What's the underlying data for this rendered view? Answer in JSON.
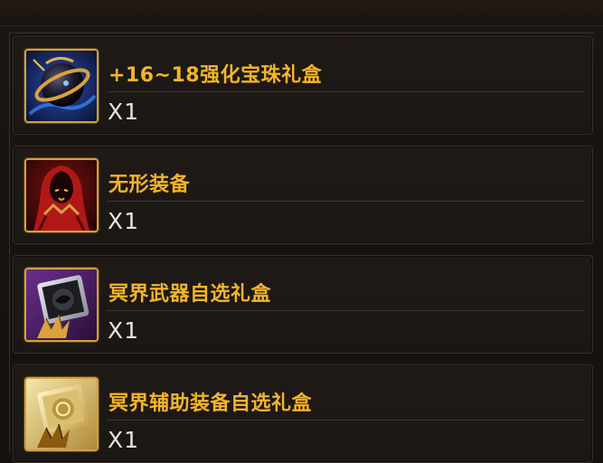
{
  "items": [
    {
      "name": "+16~18强化宝珠礼盒",
      "quantity": "X1",
      "icon": "dark-orb-icon"
    },
    {
      "name": "无形装备",
      "quantity": "X1",
      "icon": "hooded-figure-icon"
    },
    {
      "name": "冥界武器自选礼盒",
      "quantity": "X1",
      "icon": "purple-gift-box-icon"
    },
    {
      "name": "冥界辅助装备自选礼盒",
      "quantity": "X1",
      "icon": "gold-gift-box-icon"
    }
  ],
  "colors": {
    "item_name": "#f2b42c",
    "quantity": "#e8e2d8",
    "icon_border": "#cfa23f",
    "background": "#17120f"
  }
}
